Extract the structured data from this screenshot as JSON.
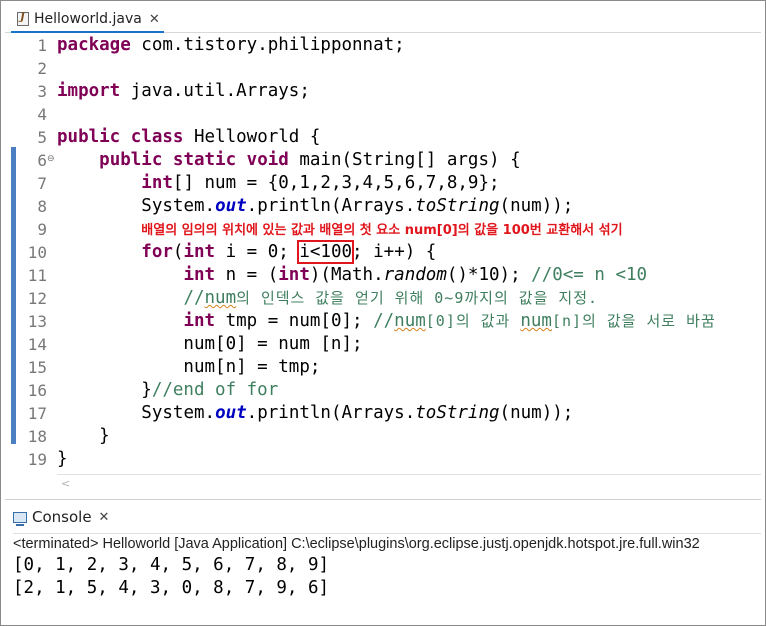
{
  "editor": {
    "tab_title": "Helloworld.java",
    "lines": {
      "n1": "1",
      "n2": "2",
      "n3": "3",
      "n4": "4",
      "n5": "5",
      "n6": "6",
      "n7": "7",
      "n8": "8",
      "n9": "9",
      "n10": "10",
      "n11": "11",
      "n12": "12",
      "n13": "13",
      "n14": "14",
      "n15": "15",
      "n16": "16",
      "n17": "17",
      "n18": "18",
      "n19": "19"
    },
    "code": {
      "l1_kw": "package",
      "l1_rest": " com.tistory.philipponnat;",
      "l3_kw": "import",
      "l3_rest": " java.util.Arrays;",
      "l5_kw": "public class",
      "l5_rest": " Helloworld {",
      "l6_indent": "    ",
      "l6_kw": "public static void",
      "l6_rest": " main(String[] args) {",
      "l7_indent": "        ",
      "l7_kw": "int",
      "l7_rest": "[] num = {0,1,2,3,4,5,6,7,8,9};",
      "l8_indent": "        ",
      "l8_a": "System.",
      "l8_field": "out",
      "l8_b": ".println(Arrays.",
      "l8_method": "toString",
      "l8_c": "(num));",
      "l10_indent": "        ",
      "l10_kw1": "for",
      "l10_a": "(",
      "l10_kw2": "int",
      "l10_b": " i = 0; ",
      "l10_boxed": "i<100",
      "l10_c": "; i++) {",
      "l11_indent": "            ",
      "l11_kw1": "int",
      "l11_a": " n = (",
      "l11_kw2": "int",
      "l11_b": ")(Math.",
      "l11_method": "random",
      "l11_c": "()*10); ",
      "l11_comment": "//0<= n <10",
      "l12_indent": "            ",
      "l12_a": "//",
      "l12_sq": "num",
      "l12_b": "의 인덱스 값을 얻기 위해 0~9까지의 값을 지정.",
      "l13_indent": "            ",
      "l13_kw": "int",
      "l13_a": " tmp = num[0]; ",
      "l13_c1": "//",
      "l13_sq1": "num",
      "l13_c2": "[0]의 값과 ",
      "l13_sq2": "num",
      "l13_c3": "[n]의 값을 서로 바꿈",
      "l14": "            num[0] = num [n];",
      "l15": "            num[n] = tmp;",
      "l16_a": "        }",
      "l16_comment": "//end of for",
      "l17_indent": "        ",
      "l17_a": "System.",
      "l17_field": "out",
      "l17_b": ".println(Arrays.",
      "l17_method": "toString",
      "l17_c": "(num));",
      "l18": "    }",
      "l19": "}"
    },
    "annotation_indent": "        ",
    "annotation": "배열의 임의의 위치에 있는 값과 배열의 첫 요소 num[0]의 값을 100번 교환해서 섞기"
  },
  "console": {
    "tab_title": "Console",
    "status": "<terminated> Helloworld [Java Application] C:\\eclipse\\plugins\\org.eclipse.justj.openjdk.hotspot.jre.full.win32",
    "output1": "[0, 1, 2, 3, 4, 5, 6, 7, 8, 9]",
    "output2": "[2, 1, 5, 4, 3, 0, 8, 7, 9, 6]"
  },
  "colors": {
    "keyword": "#7f0055",
    "comment": "#3f7f5f",
    "field": "#0000c0",
    "annotation": "#e0161c",
    "ruler": "#4a7fc1"
  }
}
